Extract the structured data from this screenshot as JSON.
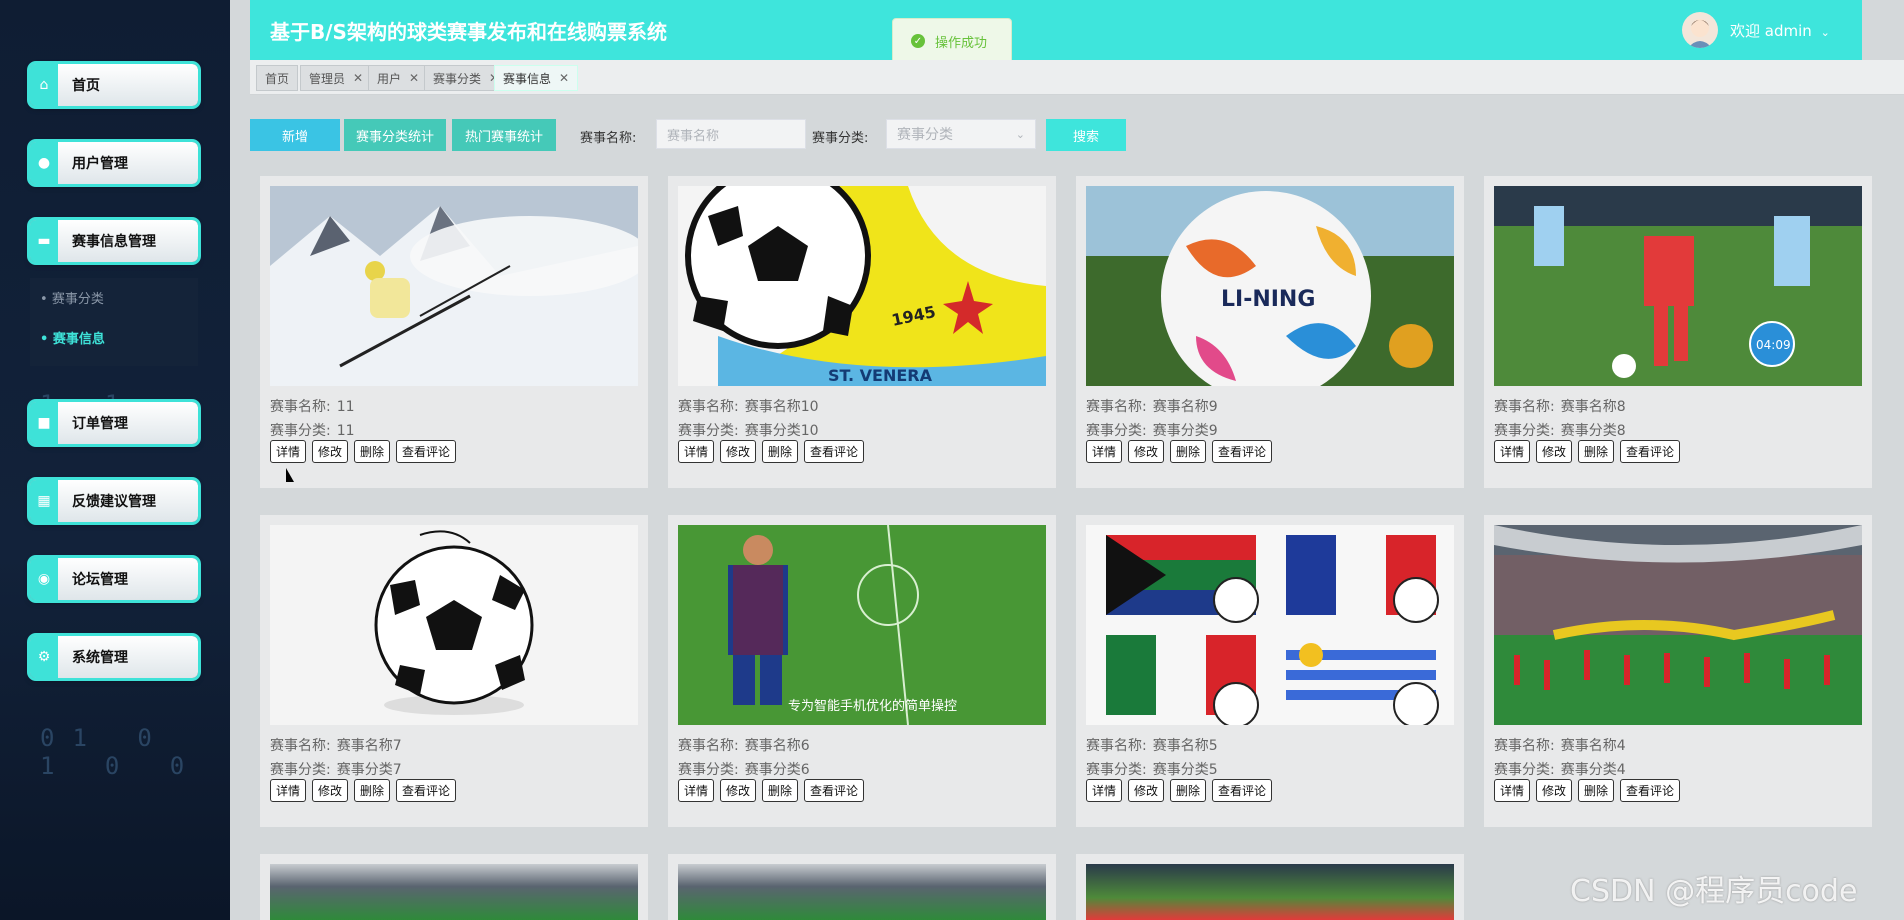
{
  "app_title": "基于B/S架构的球类赛事发布和在线购票系统",
  "header": {
    "welcome": "欢迎 admin",
    "toast": "操作成功"
  },
  "sidebar": {
    "items": [
      {
        "label": "首页",
        "icon": "home-icon"
      },
      {
        "label": "用户管理",
        "icon": "user-icon"
      },
      {
        "label": "赛事信息管理",
        "icon": "event-icon"
      },
      {
        "label": "订单管理",
        "icon": "order-icon"
      },
      {
        "label": "反馈建议管理",
        "icon": "feedback-icon"
      },
      {
        "label": "论坛管理",
        "icon": "forum-icon"
      },
      {
        "label": "系统管理",
        "icon": "system-icon"
      }
    ],
    "sub_items": [
      "赛事分类",
      "赛事信息"
    ]
  },
  "tabs": [
    {
      "label": "首页"
    },
    {
      "label": "管理员"
    },
    {
      "label": "用户"
    },
    {
      "label": "赛事分类"
    },
    {
      "label": "赛事信息"
    }
  ],
  "toolbar": {
    "add": "新增",
    "category_stats": "赛事分类统计",
    "hot_stats": "热门赛事统计",
    "name_label": "赛事名称:",
    "name_placeholder": "赛事名称",
    "category_label": "赛事分类:",
    "category_placeholder": "赛事分类",
    "search": "搜索"
  },
  "card_labels": {
    "name": "赛事名称:",
    "category": "赛事分类:"
  },
  "card_actions": [
    "详情",
    "修改",
    "删除",
    "查看评论"
  ],
  "cards": [
    {
      "name": "11",
      "category": "11"
    },
    {
      "name": "赛事名称10",
      "category": "赛事分类10"
    },
    {
      "name": "赛事名称9",
      "category": "赛事分类9"
    },
    {
      "name": "赛事名称8",
      "category": "赛事分类8"
    },
    {
      "name": "赛事名称7",
      "category": "赛事分类7"
    },
    {
      "name": "赛事名称6",
      "category": "赛事分类6"
    },
    {
      "name": "赛事名称5",
      "category": "赛事分类5"
    },
    {
      "name": "赛事名称4",
      "category": "赛事分类4"
    }
  ],
  "image_texts": {
    "ball_brand": "LI-NING",
    "crest_year": "1945",
    "crest_name": "ST. VENERA",
    "video_time": "04:09",
    "game_caption": "专为智能手机优化的简单操控"
  },
  "watermark": "CSDN @程序员code",
  "colors": {
    "accent": "#3ee5dc",
    "sidebar": "#0f1d33",
    "toast_success": "#67c23a"
  }
}
